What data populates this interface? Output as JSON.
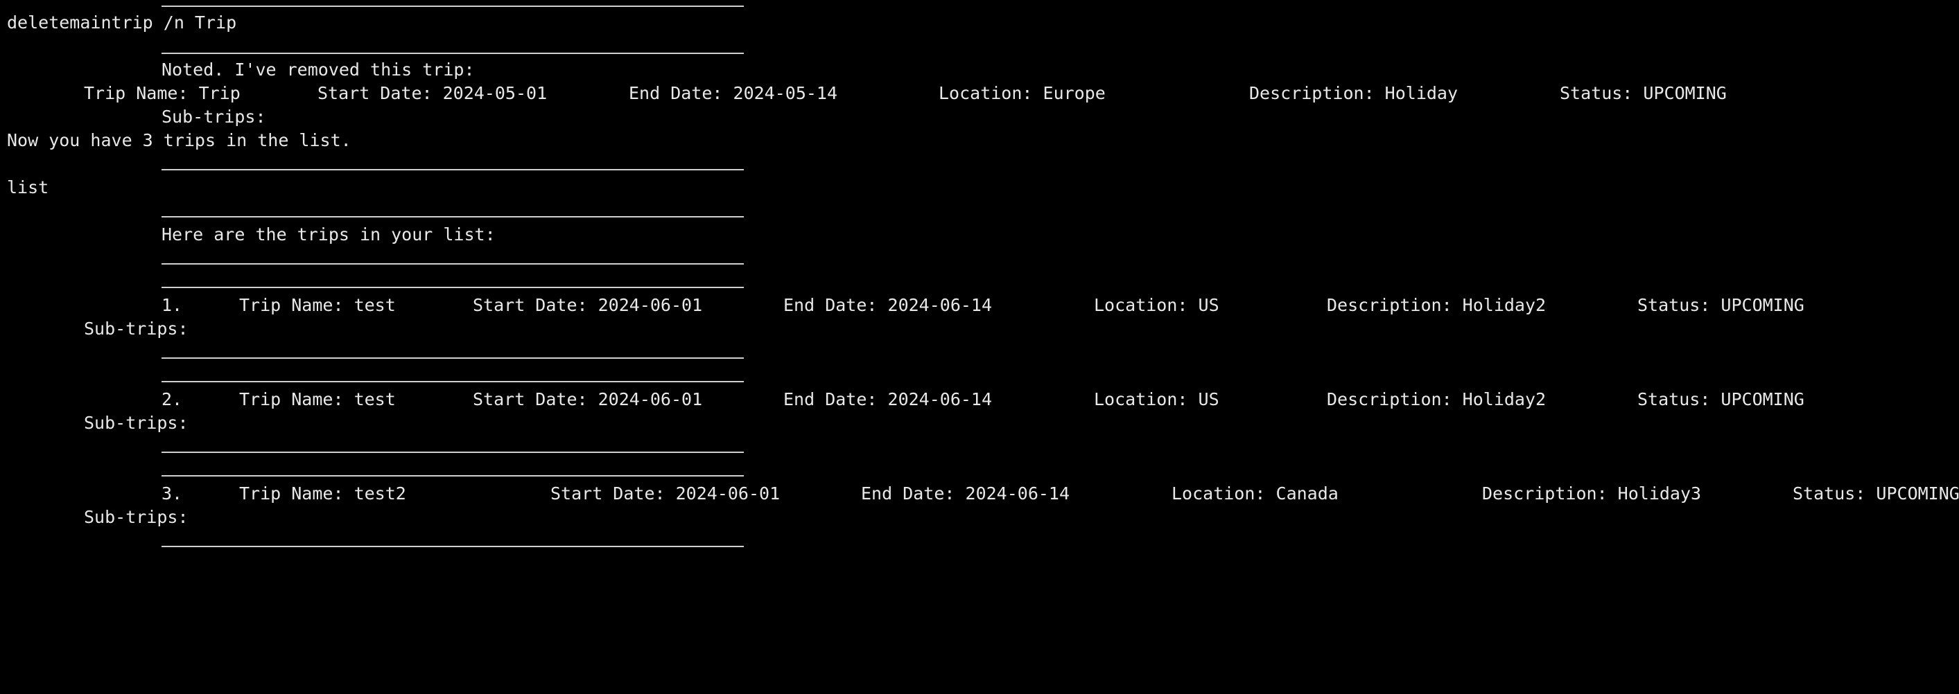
{
  "terminal": {
    "command_delete": "deletemaintrip /n Trip",
    "removed_msg": "Noted. I've removed this trip:",
    "removed_trip": {
      "name": "Trip Name: Trip",
      "start": "Start Date: 2024-05-01",
      "end": "End Date: 2024-05-14",
      "location": "Location: Europe",
      "description": "Description: Holiday",
      "status": "Status: UPCOMING",
      "subtrips": "Sub-trips:"
    },
    "count_msg": "Now you have 3 trips in the list.",
    "command_list": "list",
    "list_header": "Here are the trips in your list:",
    "trips": [
      {
        "index": "1.",
        "name": "Trip Name: test",
        "start": "Start Date: 2024-06-01",
        "end": "End Date: 2024-06-14",
        "location": "Location: US",
        "description": "Description: Holiday2",
        "status": "Status: UPCOMING",
        "subtrips": "Sub-trips:"
      },
      {
        "index": "2.",
        "name": "Trip Name: test",
        "start": "Start Date: 2024-06-01",
        "end": "End Date: 2024-06-14",
        "location": "Location: US",
        "description": "Description: Holiday2",
        "status": "Status: UPCOMING",
        "subtrips": "Sub-trips:"
      },
      {
        "index": "3.",
        "name": "Trip Name: test2",
        "start": "Start Date: 2024-06-01",
        "end": "End Date: 2024-06-14",
        "location": "Location: Canada",
        "description": "Description: Holiday3",
        "status": "Status: UPCOMING",
        "subtrips": "Sub-trips:"
      }
    ]
  },
  "colors": {
    "background": "#000000",
    "text": "#e8e8e8",
    "rule": "#d0d0d0"
  }
}
